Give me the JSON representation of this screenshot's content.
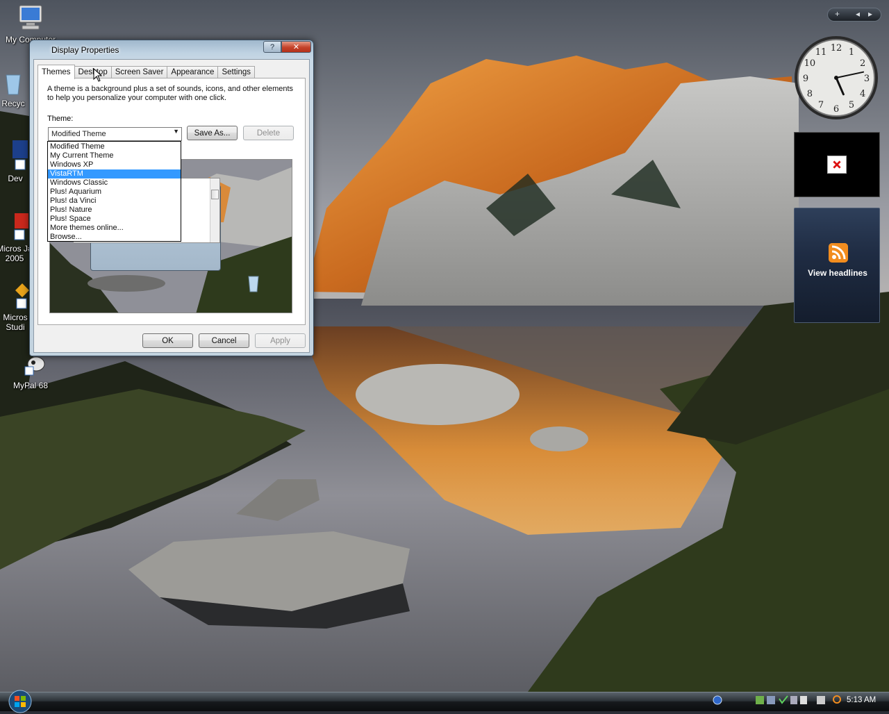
{
  "desktop": {
    "icons": [
      {
        "label": "My Computer"
      },
      {
        "label": "Recyc"
      },
      {
        "label": "Dev"
      },
      {
        "label": "Micros J# 2005"
      },
      {
        "label": "Micros Studi"
      },
      {
        "label": "MyPal 68"
      }
    ]
  },
  "dialog": {
    "title": "Display Properties",
    "help_label": "?",
    "close_label": "✕",
    "tabs": [
      {
        "label": "Themes",
        "active": true
      },
      {
        "label": "Desktop"
      },
      {
        "label": "Screen Saver"
      },
      {
        "label": "Appearance"
      },
      {
        "label": "Settings"
      }
    ],
    "description": "A theme is a background plus a set of sounds, icons, and other elements to help you personalize your computer with one click.",
    "theme_label": "Theme:",
    "theme_value": "Modified Theme",
    "save_as_label": "Save As...",
    "delete_label": "Delete",
    "theme_options": [
      "Modified Theme",
      "My Current Theme",
      "Windows XP",
      "VistaRTM",
      "Windows Classic",
      "Plus! Aquarium",
      "Plus! da Vinci",
      "Plus! Nature",
      "Plus! Space",
      "More themes online...",
      "Browse..."
    ],
    "selected_option_index": 3,
    "ok_label": "OK",
    "cancel_label": "Cancel",
    "apply_label": "Apply"
  },
  "sidebar": {
    "add_label": "+",
    "prev_label": "◂",
    "next_label": "▸",
    "clock_numbers": [
      "12",
      "1",
      "2",
      "3",
      "4",
      "5",
      "6",
      "7",
      "8",
      "9",
      "10",
      "11"
    ],
    "clock_time": {
      "hours": 5,
      "minutes": 13
    },
    "feed_label": "View headlines"
  },
  "taskbar": {
    "time": "5:13 AM"
  },
  "colors": {
    "selection": "#3399ff",
    "taskbar": "#16191c",
    "feed_gadget": "#1f2c43"
  }
}
